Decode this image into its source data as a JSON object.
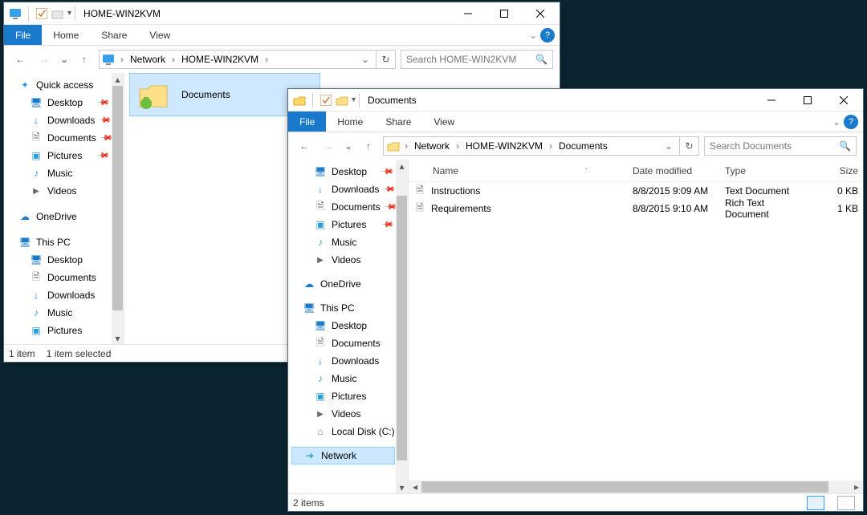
{
  "win1": {
    "title": "HOME-WIN2KVM",
    "ribbon": {
      "file": "File",
      "home": "Home",
      "share": "Share",
      "view": "View"
    },
    "breadcrumb": {
      "root": "Network",
      "p1": "HOME-WIN2KVM"
    },
    "search_placeholder": "Search HOME-WIN2KVM",
    "nav": {
      "quick": "Quick access",
      "desktop": "Desktop",
      "downloads": "Downloads",
      "documents": "Documents",
      "pictures": "Pictures",
      "music": "Music",
      "videos": "Videos",
      "onedrive": "OneDrive",
      "thispc": "This PC",
      "pc_desktop": "Desktop",
      "pc_documents": "Documents",
      "pc_downloads": "Downloads",
      "pc_music": "Music",
      "pc_pictures": "Pictures"
    },
    "item_label": "Documents",
    "status": {
      "count": "1 item",
      "selected": "1 item selected"
    }
  },
  "win2": {
    "title": "Documents",
    "ribbon": {
      "file": "File",
      "home": "Home",
      "share": "Share",
      "view": "View"
    },
    "breadcrumb": {
      "root": "Network",
      "p1": "HOME-WIN2KVM",
      "p2": "Documents"
    },
    "search_placeholder": "Search Documents",
    "nav": {
      "desktop": "Desktop",
      "downloads": "Downloads",
      "documents": "Documents",
      "pictures": "Pictures",
      "music": "Music",
      "videos": "Videos",
      "onedrive": "OneDrive",
      "thispc": "This PC",
      "pc_desktop": "Desktop",
      "pc_documents": "Documents",
      "pc_downloads": "Downloads",
      "pc_music": "Music",
      "pc_pictures": "Pictures",
      "pc_videos": "Videos",
      "localdisk": "Local Disk (C:)",
      "network": "Network"
    },
    "columns": {
      "name": "Name",
      "date": "Date modified",
      "type": "Type",
      "size": "Size"
    },
    "files": [
      {
        "name": "Instructions",
        "date": "8/8/2015 9:09 AM",
        "type": "Text Document",
        "size": "0 KB"
      },
      {
        "name": "Requirements",
        "date": "8/8/2015 9:10 AM",
        "type": "Rich Text Document",
        "size": "1 KB"
      }
    ],
    "status": {
      "count": "2 items"
    }
  }
}
